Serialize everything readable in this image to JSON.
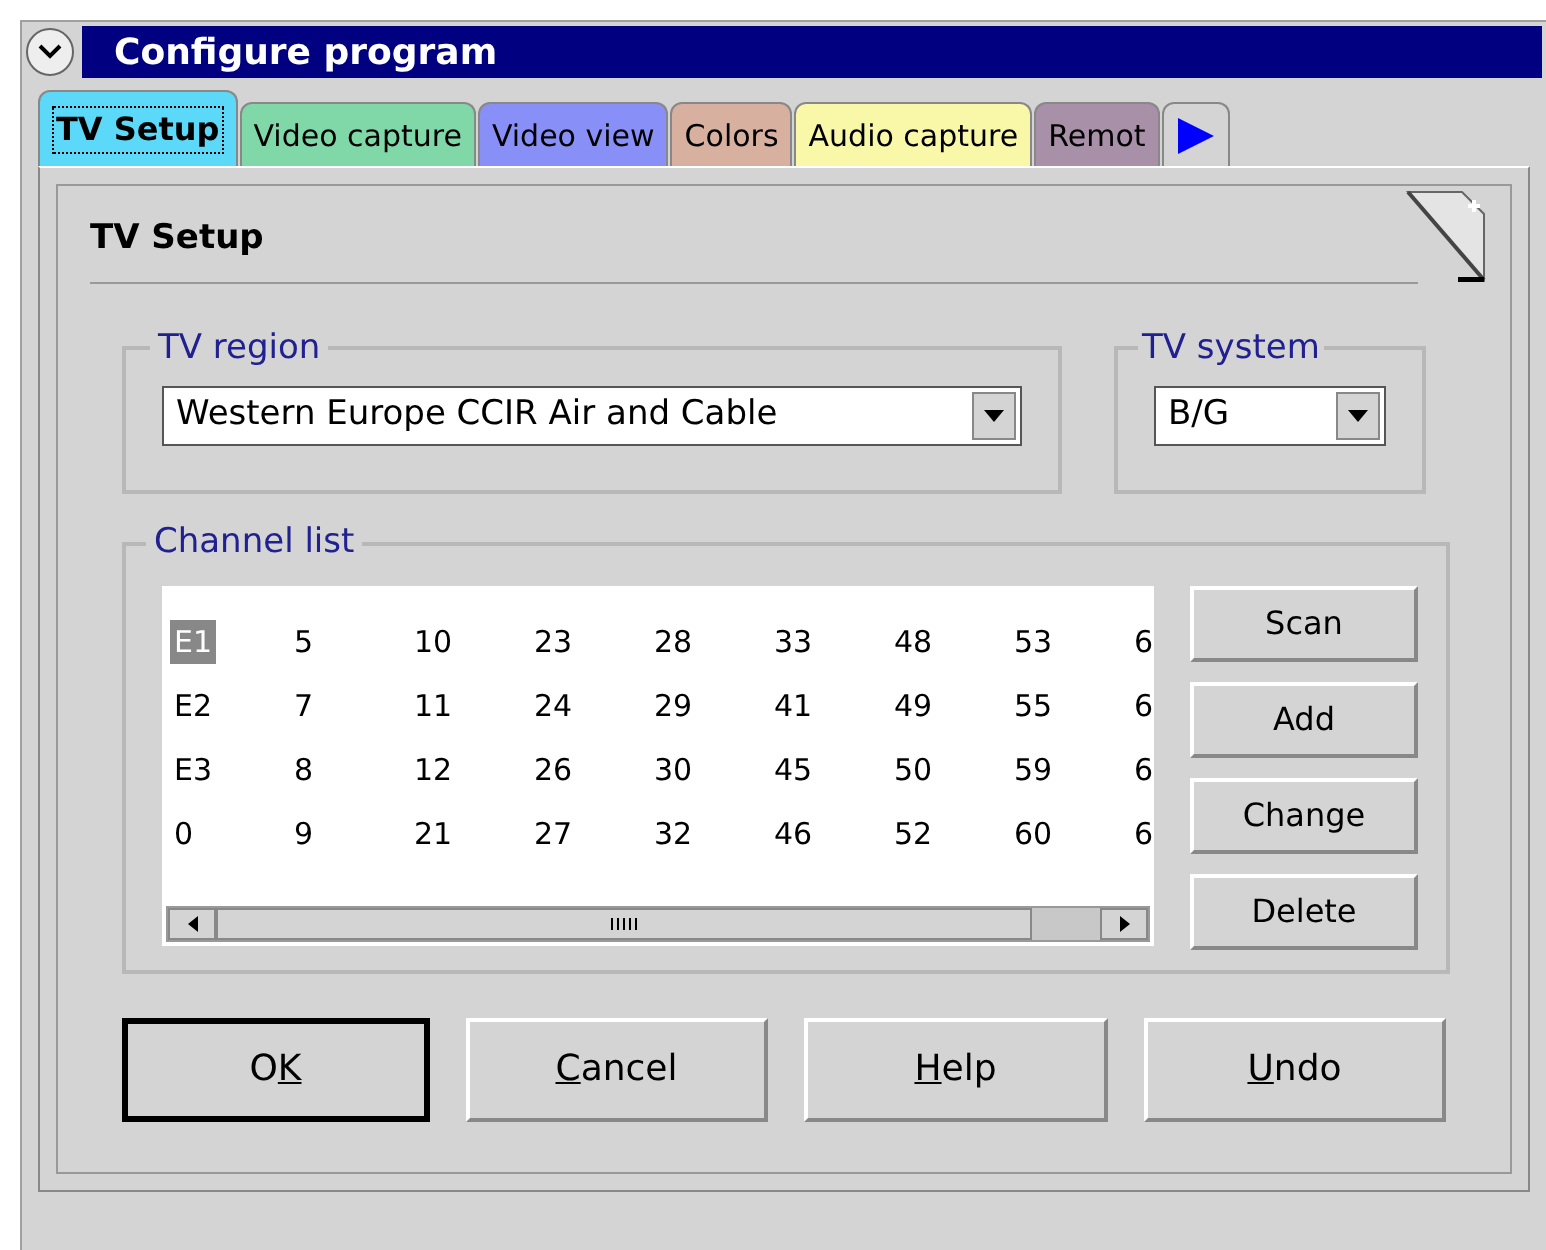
{
  "window": {
    "title": "Configure program"
  },
  "tabs": [
    {
      "label": "TV Setup",
      "selected": true,
      "color": "#5cd8f8"
    },
    {
      "label": "Video capture",
      "selected": false,
      "color": "#80d8a8"
    },
    {
      "label": "Video view",
      "selected": false,
      "color": "#8890f8"
    },
    {
      "label": "Colors",
      "selected": false,
      "color": "#d8b0a0"
    },
    {
      "label": "Audio capture",
      "selected": false,
      "color": "#f8f8a8"
    },
    {
      "label": "Remot",
      "selected": false,
      "color": "#a890a8"
    }
  ],
  "page": {
    "title": "TV Setup"
  },
  "tv_region": {
    "label": "TV region",
    "value": "Western Europe CCIR Air and Cable"
  },
  "tv_system": {
    "label": "TV system",
    "value": "B/G"
  },
  "channel_list": {
    "label": "Channel list",
    "columns": [
      [
        {
          "text": "E1",
          "selected": true
        },
        {
          "text": "E2",
          "selected": false
        },
        {
          "text": "E3",
          "selected": false
        },
        {
          "text": "0",
          "selected": false
        }
      ],
      [
        {
          "text": "5",
          "selected": false
        },
        {
          "text": "7",
          "selected": false
        },
        {
          "text": "8",
          "selected": false
        },
        {
          "text": "9",
          "selected": false
        }
      ],
      [
        {
          "text": "10",
          "selected": false
        },
        {
          "text": "11",
          "selected": false
        },
        {
          "text": "12",
          "selected": false
        },
        {
          "text": "21",
          "selected": false
        }
      ],
      [
        {
          "text": "23",
          "selected": false
        },
        {
          "text": "24",
          "selected": false
        },
        {
          "text": "26",
          "selected": false
        },
        {
          "text": "27",
          "selected": false
        }
      ],
      [
        {
          "text": "28",
          "selected": false
        },
        {
          "text": "29",
          "selected": false
        },
        {
          "text": "30",
          "selected": false
        },
        {
          "text": "32",
          "selected": false
        }
      ],
      [
        {
          "text": "33",
          "selected": false
        },
        {
          "text": "41",
          "selected": false
        },
        {
          "text": "45",
          "selected": false
        },
        {
          "text": "46",
          "selected": false
        }
      ],
      [
        {
          "text": "48",
          "selected": false
        },
        {
          "text": "49",
          "selected": false
        },
        {
          "text": "50",
          "selected": false
        },
        {
          "text": "52",
          "selected": false
        }
      ],
      [
        {
          "text": "53",
          "selected": false
        },
        {
          "text": "55",
          "selected": false
        },
        {
          "text": "59",
          "selected": false
        },
        {
          "text": "60",
          "selected": false
        }
      ],
      [
        {
          "text": "6",
          "selected": false
        },
        {
          "text": "6",
          "selected": false
        },
        {
          "text": "6",
          "selected": false
        },
        {
          "text": "6",
          "selected": false
        }
      ]
    ],
    "buttons": [
      "Scan",
      "Add",
      "Change",
      "Delete"
    ]
  },
  "dialog_buttons": [
    {
      "pre": "O",
      "key": "K",
      "default": true
    },
    {
      "key": "C",
      "post": "ancel",
      "default": false
    },
    {
      "key": "H",
      "post": "elp",
      "default": false
    },
    {
      "key": "U",
      "post": "ndo",
      "default": false
    }
  ]
}
